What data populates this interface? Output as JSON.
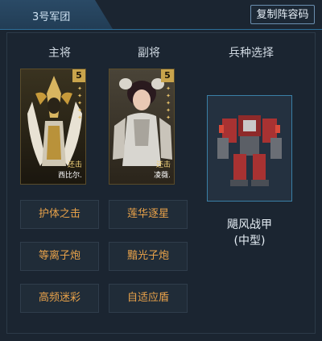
{
  "header": {
    "tab_label": "3号军团",
    "copy_button": "复制阵容码"
  },
  "columns": {
    "main": "主将",
    "vice": "副将",
    "unit": "兵种选择"
  },
  "generals": [
    {
      "role": "main",
      "level": "5",
      "tag": "还击",
      "name": "西比尔.",
      "stars": 5
    },
    {
      "role": "vice",
      "level": "5",
      "tag": "还击",
      "name": "凌薇.",
      "stars": 5
    }
  ],
  "unit": {
    "name_line1": "飓风战甲",
    "name_line2": "(中型)"
  },
  "skills": [
    [
      "护体之击",
      "莲华逐星"
    ],
    [
      "等离子炮",
      "黯光子炮"
    ],
    [
      "高频迷彩",
      "自适应盾"
    ]
  ],
  "colors": {
    "skill_text": "#e8a24a",
    "accent": "#3a7fa6",
    "gold": "#c9a44c"
  }
}
